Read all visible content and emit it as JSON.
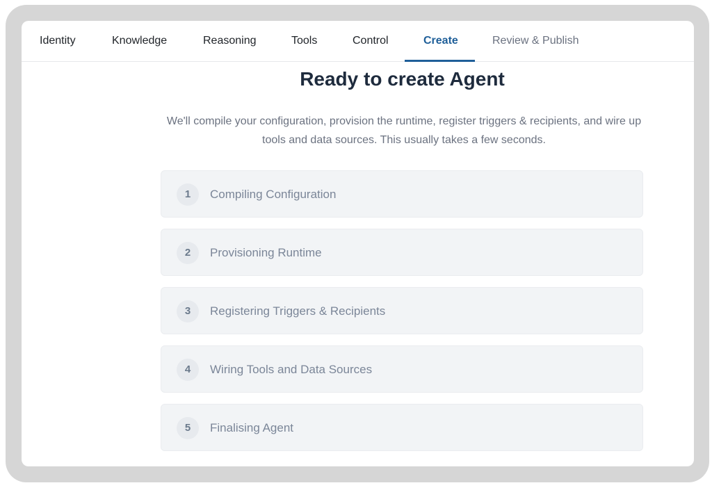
{
  "tabs": [
    {
      "label": "Identity"
    },
    {
      "label": "Knowledge"
    },
    {
      "label": "Reasoning"
    },
    {
      "label": "Tools"
    },
    {
      "label": "Control"
    },
    {
      "label": "Create"
    },
    {
      "label": "Review & Publish"
    }
  ],
  "active_tab": "Create",
  "main": {
    "title": "Ready to create Agent",
    "description": "We'll compile your configuration, provision the runtime, register triggers & recipients, and wire up tools and data sources. This usually takes a few seconds."
  },
  "steps": [
    {
      "number": "1",
      "label": "Compiling Configuration"
    },
    {
      "number": "2",
      "label": "Provisioning Runtime"
    },
    {
      "number": "3",
      "label": "Registering Triggers & Recipients"
    },
    {
      "number": "4",
      "label": "Wiring Tools and Data Sources"
    },
    {
      "number": "5",
      "label": "Finalising Agent"
    }
  ],
  "colors": {
    "accent": "#1f5f99",
    "frame": "#d6d6d6",
    "step_bg": "#f2f4f6",
    "text_muted": "#6b7280"
  }
}
